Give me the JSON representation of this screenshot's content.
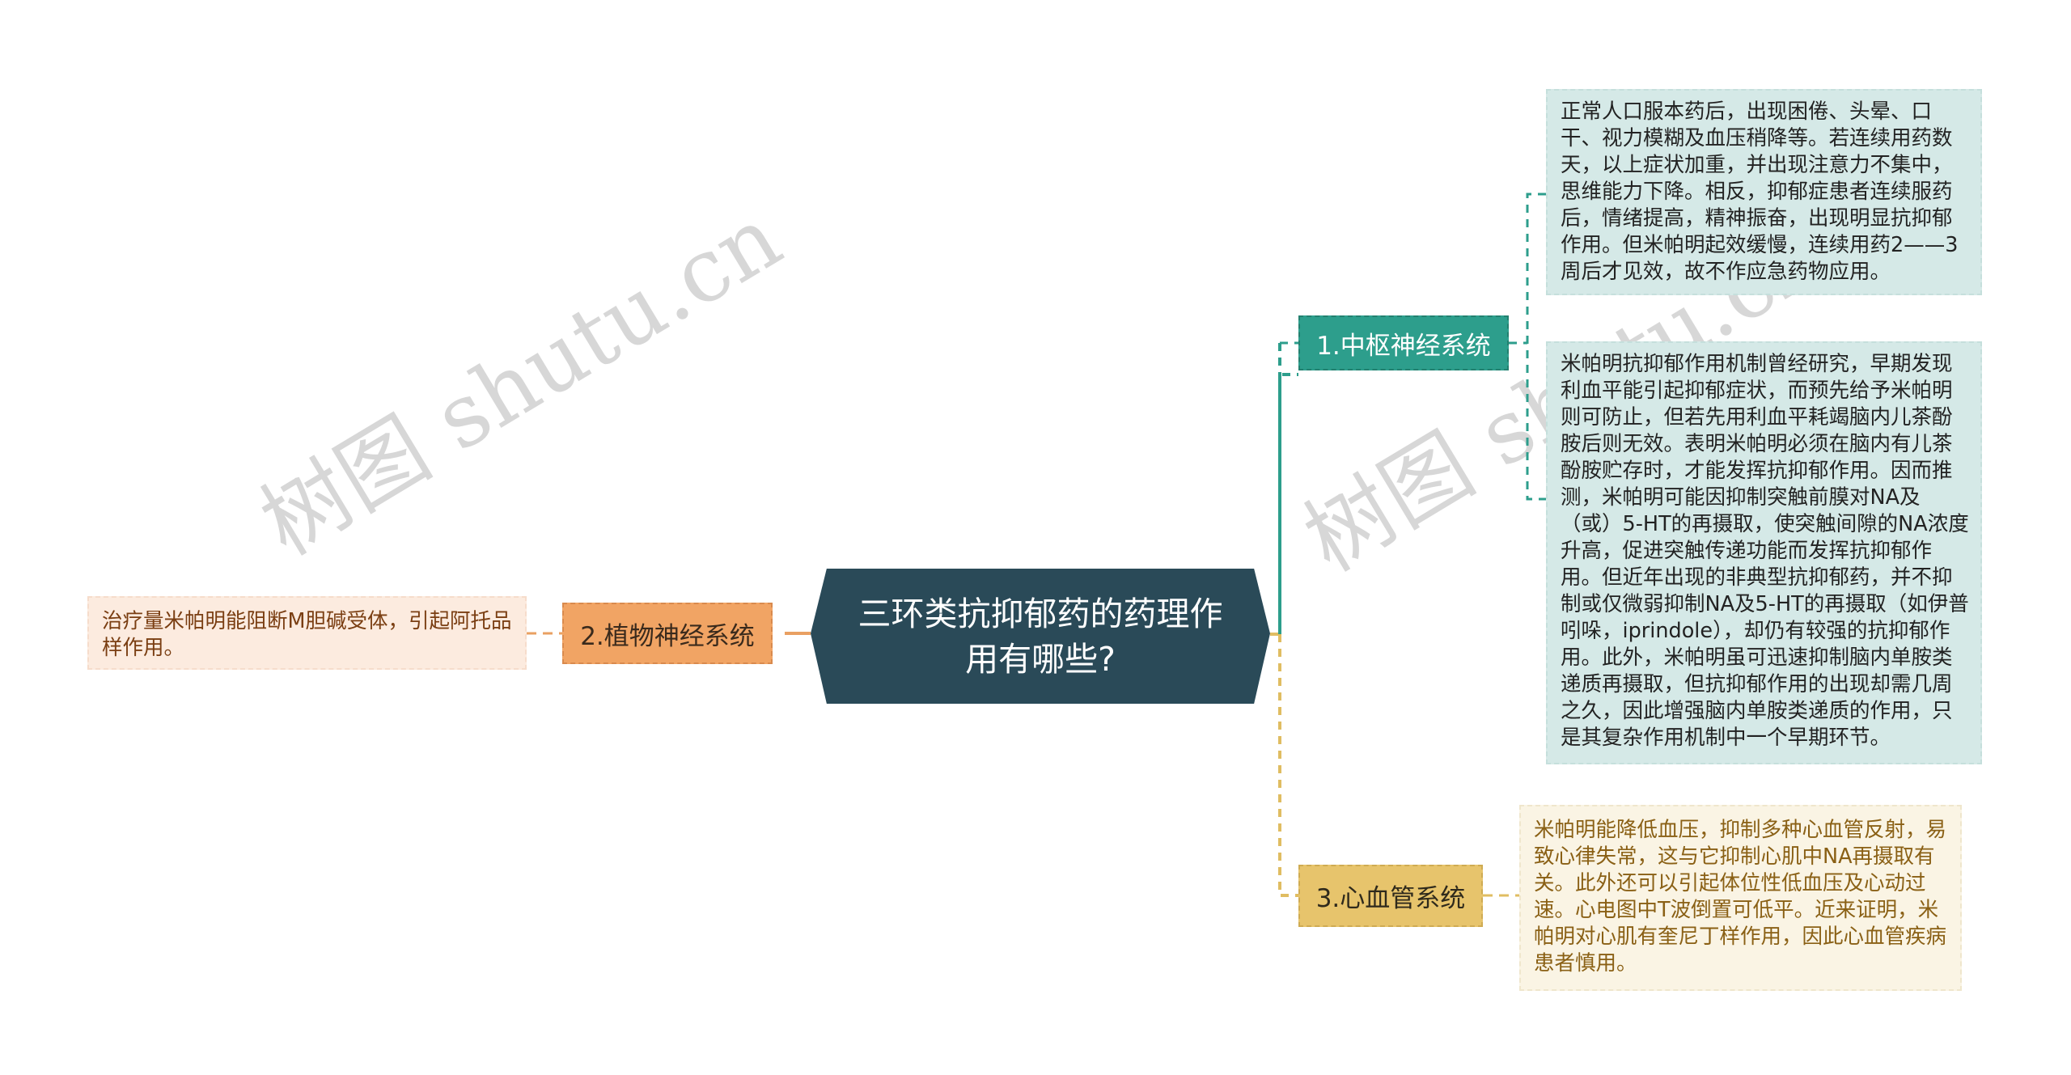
{
  "watermark": "树图 shutu.cn",
  "root": {
    "title": "三环类抗抑郁药的药理作用有哪些?"
  },
  "colors": {
    "root": "#2a4a58",
    "branch_cns": "#2d9e8c",
    "branch_ans": "#f1a464",
    "branch_cv": "#e7c46c",
    "card_cns": "#d5e9e7",
    "card_ans": "#fcebdf",
    "card_cv": "#faf4e4"
  },
  "branches": [
    {
      "label": "1.中枢神经系统",
      "side": "right",
      "cards": [
        "正常人口服本药后，出现困倦、头晕、口干、视力模糊及血压稍降等。若连续用药数天，以上症状加重，并出现注意力不集中，思维能力下降。相反，抑郁症患者连续服药后，情绪提高，精神振奋，出现明显抗抑郁作用。但米帕明起效缓慢，连续用药2——3周后才见效，故不作应急药物应用。",
        "米帕明抗抑郁作用机制曾经研究，早期发现利血平能引起抑郁症状，而预先给予米帕明则可防止，但若先用利血平耗竭脑内儿茶酚胺后则无效。表明米帕明必须在脑内有儿茶酚胺贮存时，才能发挥抗抑郁作用。因而推测，米帕明可能因抑制突触前膜对NA及（或）5-HT的再摄取，使突触间隙的NA浓度升高，促进突触传递功能而发挥抗抑郁作用。但近年出现的非典型抗抑郁药，并不抑制或仅微弱抑制NA及5-HT的再摄取（如伊普吲哚，iprindole），却仍有较强的抗抑郁作用。此外，米帕明虽可迅速抑制脑内单胺类递质再摄取，但抗抑郁作用的出现却需几周之久，因此增强脑内单胺类递质的作用，只是其复杂作用机制中一个早期环节。"
      ]
    },
    {
      "label": "2.植物神经系统",
      "side": "left",
      "cards": [
        "治疗量米帕明能阻断M胆碱受体，引起阿托品样作用。"
      ]
    },
    {
      "label": "3.心血管系统",
      "side": "right",
      "cards": [
        "米帕明能降低血压，抑制多种心血管反射，易致心律失常，这与它抑制心肌中NA再摄取有关。此外还可以引起体位性低血压及心动过速。心电图中T波倒置可低平。近来证明，米帕明对心肌有奎尼丁样作用，因此心血管疾病患者慎用。"
      ]
    }
  ]
}
